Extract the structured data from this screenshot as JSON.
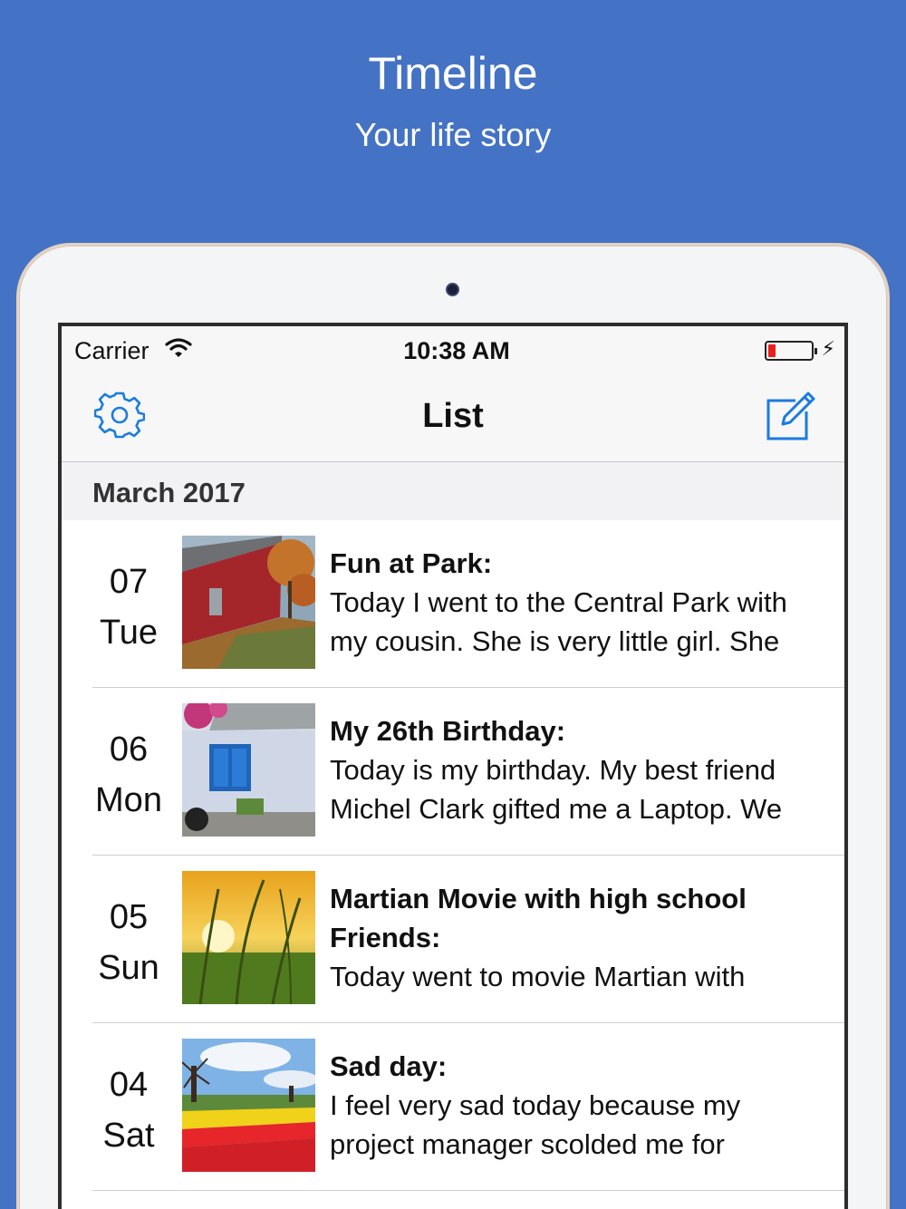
{
  "promo": {
    "title": "Timeline",
    "subtitle": "Your life story"
  },
  "status_bar": {
    "carrier": "Carrier",
    "time": "10:38 AM"
  },
  "nav": {
    "title": "List"
  },
  "section": {
    "header": "March 2017"
  },
  "entries": [
    {
      "day": "07",
      "weekday": "Tue",
      "title": "Fun at Park:",
      "line1": "Today I went to the Central Park with",
      "line2": "my cousin. She is very little girl. She"
    },
    {
      "day": "06",
      "weekday": "Mon",
      "title": "My 26th Birthday:",
      "line1": "Today is my birthday. My best friend",
      "line2": "Michel Clark gifted me a Laptop. We"
    },
    {
      "day": "05",
      "weekday": "Sun",
      "title_line1": "Martian Movie with high school",
      "title_line2": "Friends:",
      "line1": "Today went to movie Martian with"
    },
    {
      "day": "04",
      "weekday": "Sat",
      "title": "Sad day:",
      "line1": "I feel very sad today because my",
      "line2": "project manager scolded me for"
    }
  ],
  "colors": {
    "background": "#4472c4",
    "accent": "#1a7be0",
    "battery_low": "#e6201c"
  },
  "icons": {
    "settings": "gear-icon",
    "compose": "compose-icon",
    "wifi": "wifi-icon",
    "battery": "battery-icon"
  }
}
